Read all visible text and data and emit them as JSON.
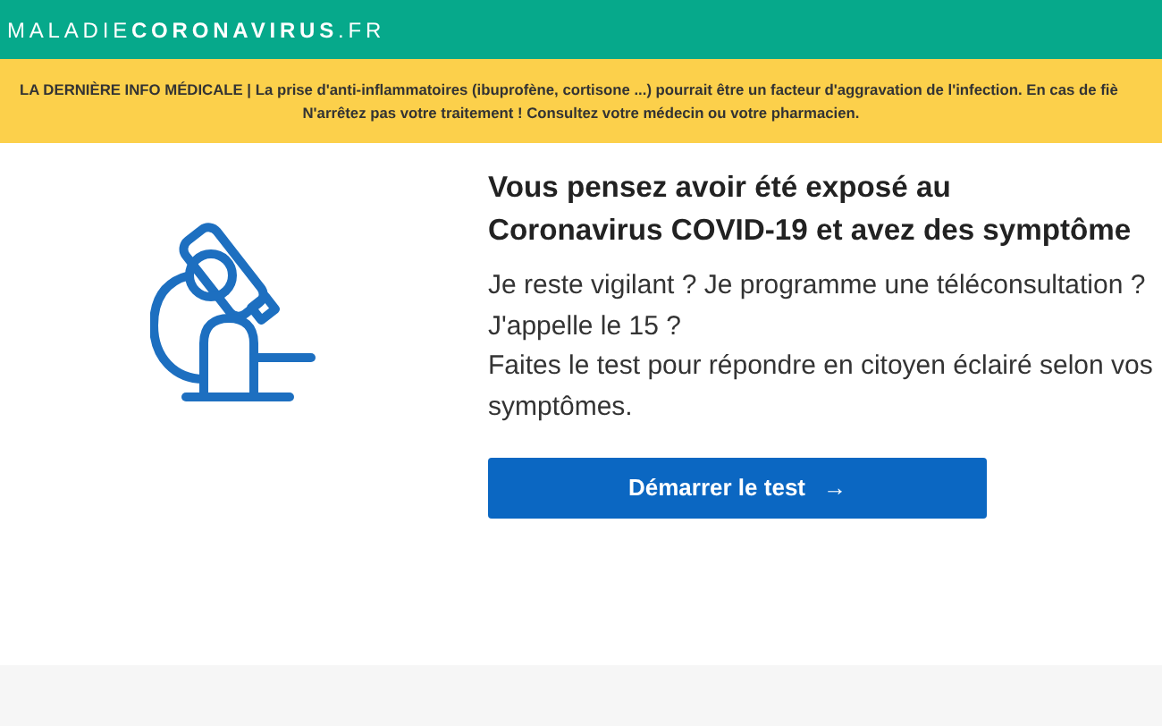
{
  "header": {
    "logo": "MALADIE**CORONAVIRUS**.FR"
  },
  "banner": {
    "lines": [
      "LA DERNIÈRE INFO MÉDICALE | La prise d'anti-inflammatoires (ibuprofène, cortisone ...) pourrait être un facteur d'aggravation de l'infection. En cas de fiè",
      "N'arrêtez pas votre traitement ! Consultez votre médecin ou votre pharmacien."
    ]
  },
  "main": {
    "heading_lines": [
      "Vous pensez avoir été exposé au",
      "Coronavirus COVID-19 et avez des symptôme"
    ],
    "body_lines": [
      "Je reste vigilant ? Je programme une téléconsultation ?",
      "J'appelle le 15 ?",
      "Faites le test pour répondre en citoyen éclairé selon vos",
      "symptômes."
    ],
    "button": {
      "label": "Démarrer le test",
      "arrow": "→"
    }
  }
}
